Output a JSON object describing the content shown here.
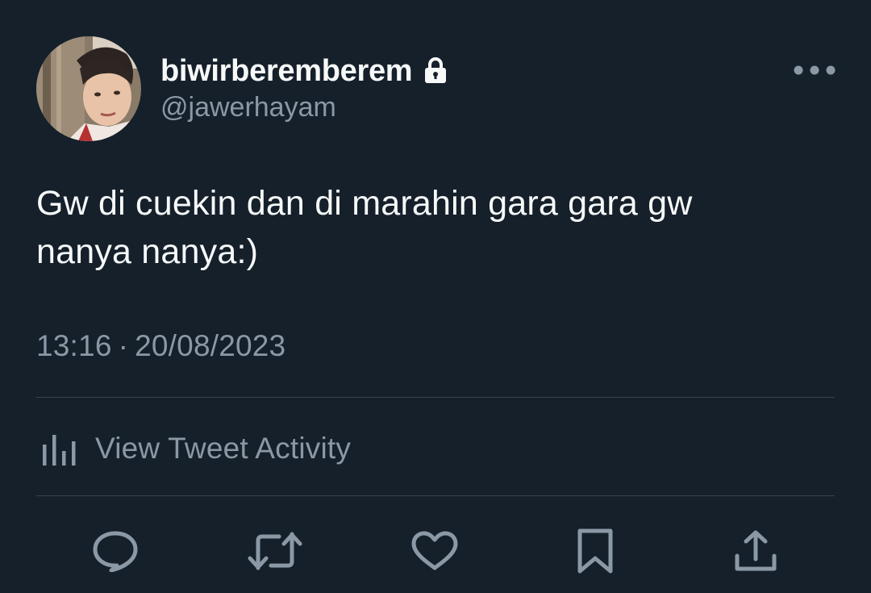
{
  "author": {
    "display_name": "biwirberemberem",
    "handle": "@jawerhayam",
    "protected_icon": "lock-icon",
    "avatar": "profile-photo"
  },
  "tweet": {
    "text": "Gw di cuekin dan di marahin gara gara gw\nnanya nanya:)",
    "time": "13:16",
    "separator": "·",
    "date": "20/08/2023"
  },
  "activity": {
    "icon": "analytics-icon",
    "label": "View Tweet Activity"
  },
  "actions": [
    {
      "name": "reply",
      "icon": "reply-icon"
    },
    {
      "name": "retweet",
      "icon": "retweet-icon"
    },
    {
      "name": "like",
      "icon": "heart-icon"
    },
    {
      "name": "bookmark",
      "icon": "bookmark-icon"
    },
    {
      "name": "share",
      "icon": "share-icon"
    }
  ],
  "colors": {
    "background": "#15202b",
    "primary_text": "#f7f9f9",
    "secondary_text": "#8b98a5",
    "divider": "#38444d"
  }
}
